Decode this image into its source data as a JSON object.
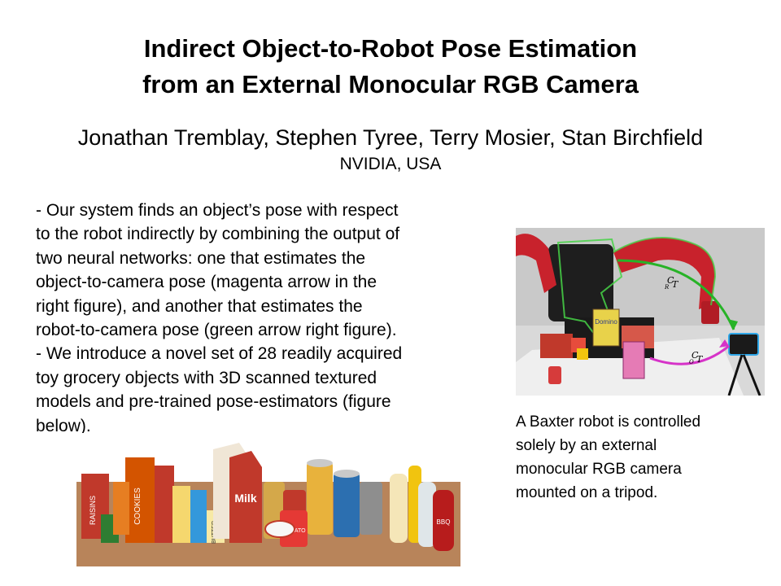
{
  "title": {
    "line1": "Indirect Object-to-Robot Pose Estimation",
    "line2": "from an External Monocular RGB Camera"
  },
  "authors": "Jonathan Tremblay, Stephen Tyree, Terry Mosier, Stan Birchfield",
  "affiliation": "NVIDIA, USA",
  "body": {
    "lines": [
      "- Our system finds an object’s pose with respect",
      "to the robot indirectly by combining the output of",
      "two neural networks: one that estimates the",
      "object-to-camera pose (magenta arrow in the",
      "right figure), and another that estimates the",
      "robot-to-camera pose (green arrow right figure).",
      "- We introduce a novel set of 28 readily acquired",
      "toy grocery objects with 3D scanned textured",
      "models and pre-trained pose-estimators (figure",
      "below)."
    ]
  },
  "caption": {
    "lines": [
      "A Baxter robot is controlled",
      "solely by an external",
      "monocular RGB camera",
      "mounted on a tripod."
    ]
  },
  "robot_figure": {
    "label_robot": "C",
    "label_robot_sub": "R",
    "label_object": "C",
    "label_object_sub": "O",
    "label_T": "T",
    "box_text": "Domino",
    "colors": {
      "robot_red": "#c8222c",
      "robot_black": "#1e1e1e",
      "green_arrow": "#27b327",
      "magenta_arrow": "#d633c8",
      "table": "#e9e9e9"
    }
  },
  "grocery_figure": {
    "labels": {
      "raisins": "RAISINS",
      "cookies": "COOKIES",
      "milk": "Milk",
      "butter": "BUTTER",
      "bbq": "BBQ",
      "tomato": "TOMATO"
    },
    "colors": {
      "table": "#b8845a",
      "wall": "#ffffff"
    }
  }
}
